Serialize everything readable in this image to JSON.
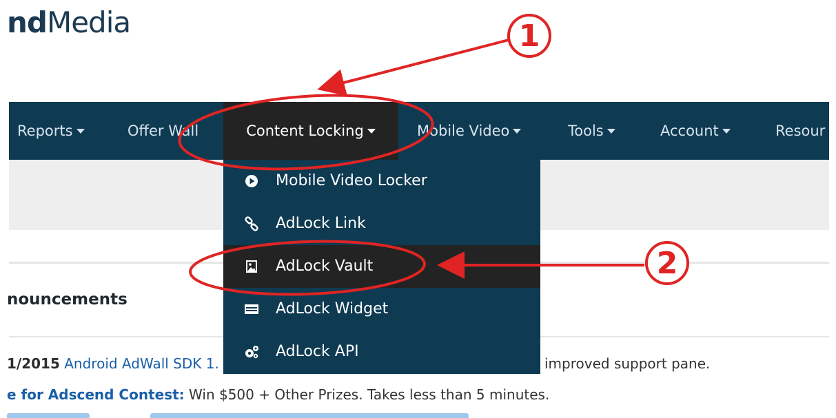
{
  "logo": {
    "bold": "nd",
    "regular": "Media"
  },
  "nav": {
    "items": [
      {
        "label": "Reports",
        "caret": true
      },
      {
        "label": "Offer Wall",
        "caret": false
      },
      {
        "label": "Content Locking",
        "caret": true,
        "active": true
      },
      {
        "label": "Mobile Video",
        "caret": true
      },
      {
        "label": "Tools",
        "caret": true
      },
      {
        "label": "Account",
        "caret": true
      },
      {
        "label": "Resour",
        "caret": false
      }
    ]
  },
  "dropdown": {
    "items": [
      {
        "label": "Mobile Video Locker",
        "icon": "play-circle-icon"
      },
      {
        "label": "AdLock Link",
        "icon": "link-icon"
      },
      {
        "label": "AdLock Vault",
        "icon": "image-file-icon",
        "highlighted": true
      },
      {
        "label": "AdLock Widget",
        "icon": "widget-icon"
      },
      {
        "label": "AdLock API",
        "icon": "gears-icon"
      }
    ]
  },
  "announcements": {
    "title": "nouncements",
    "line1": {
      "date": "1/2015",
      "link": "Android AdWall SDK 1.",
      "rest": "improved support pane."
    },
    "line2": {
      "link": "e for Adscend Contest:",
      "rest": " Win $500 + Other Prizes. Takes less than 5 minutes."
    }
  },
  "annotations": {
    "first": "1",
    "second": "2"
  },
  "colors": {
    "nav_bg": "#0e3a52",
    "active_bg": "#232323",
    "annotation": "#e02424",
    "link": "#1a5fa8"
  }
}
